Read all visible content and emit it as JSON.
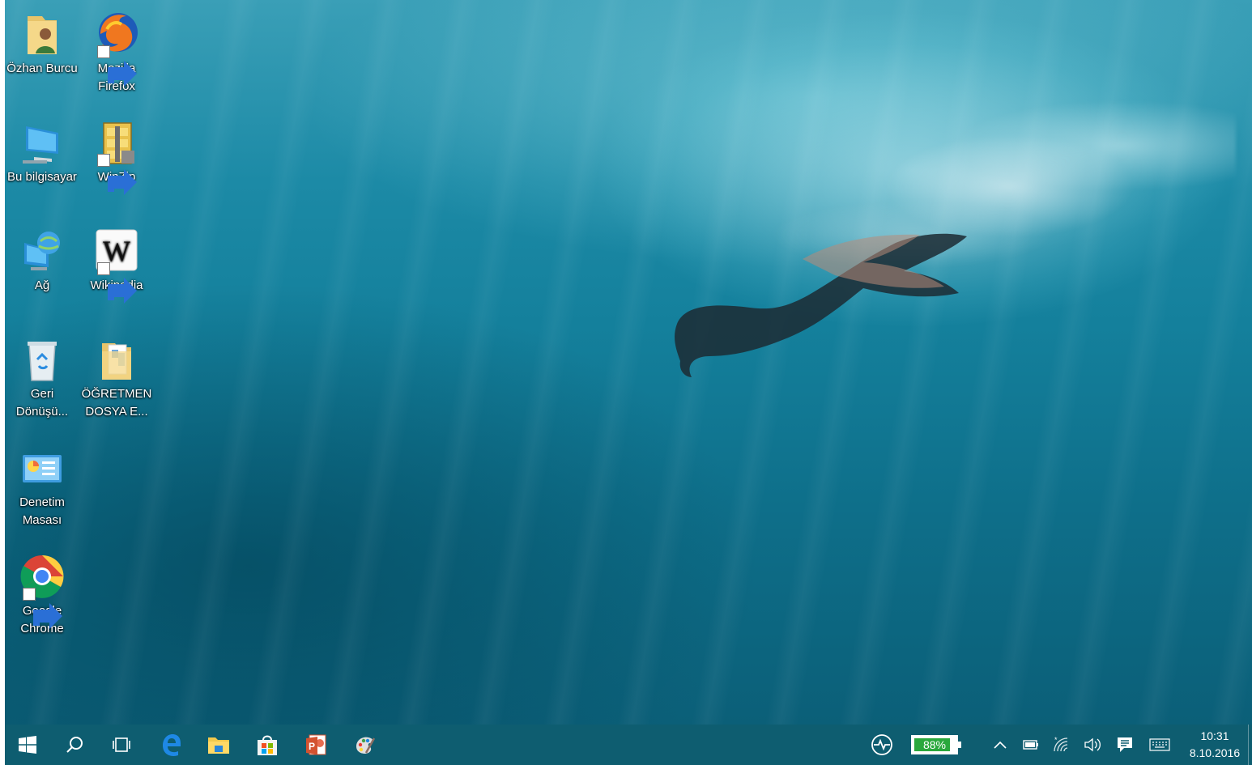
{
  "desktop": {
    "icons": [
      {
        "label_lines": [
          "Özhan Burcu"
        ],
        "icon": "user-folder-icon"
      },
      {
        "label_lines": [
          "Mozilla",
          "Firefox"
        ],
        "icon": "firefox-icon"
      },
      {
        "label_lines": [
          "Bu bilgisayar"
        ],
        "icon": "this-pc-icon"
      },
      {
        "label_lines": [
          "WinZip"
        ],
        "icon": "winzip-icon"
      },
      {
        "label_lines": [
          "Ağ"
        ],
        "icon": "network-icon"
      },
      {
        "label_lines": [
          "Wikipedia"
        ],
        "icon": "wikipedia-icon"
      },
      {
        "label_lines": [
          "Geri",
          "Dönüşü..."
        ],
        "icon": "recycle-bin-icon"
      },
      {
        "label_lines": [
          "ÖĞRETMEN",
          "DOSYA E..."
        ],
        "icon": "folder-icon"
      },
      {
        "label_lines": [
          "Denetim",
          "Masası"
        ],
        "icon": "control-panel-icon"
      },
      {
        "label_lines": [
          "Google",
          "Chrome"
        ],
        "icon": "chrome-icon"
      }
    ]
  },
  "taskbar": {
    "apps": [
      "start-icon",
      "search-icon",
      "task-view-icon",
      "edge-icon",
      "file-explorer-icon",
      "store-icon",
      "powerpoint-icon",
      "paint-icon"
    ],
    "tray": {
      "battery_percent_label": "88%",
      "battery_level": 0.88,
      "battery_color": "#2aa83c",
      "icons": [
        "health-monitor-icon",
        "chevron-up-icon",
        "battery-icon",
        "wifi-icon",
        "volume-icon",
        "action-center-icon",
        "touch-keyboard-icon"
      ]
    },
    "clock": {
      "time": "10:31",
      "date": "8.10.2016"
    }
  },
  "colors": {
    "taskbar": "#0e5d70",
    "water": "#14809c"
  }
}
